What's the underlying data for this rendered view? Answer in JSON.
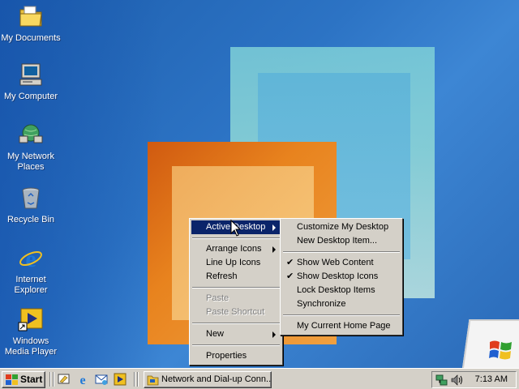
{
  "desktop": {
    "icons": [
      {
        "label": "My Documents",
        "icon": "my-documents-icon"
      },
      {
        "label": "My Computer",
        "icon": "my-computer-icon"
      },
      {
        "label": "My Network Places",
        "icon": "network-places-icon"
      },
      {
        "label": "Recycle Bin",
        "icon": "recycle-bin-icon"
      },
      {
        "label": "Internet Explorer",
        "icon": "internet-explorer-icon"
      },
      {
        "label": "Windows Media Player",
        "icon": "media-player-icon"
      }
    ]
  },
  "context_menu": {
    "items": [
      {
        "label": "Active Desktop",
        "submenu": true,
        "selected": true
      },
      {
        "label": "Arrange Icons",
        "submenu": true
      },
      {
        "label": "Line Up Icons"
      },
      {
        "label": "Refresh"
      },
      {
        "label": "Paste",
        "disabled": true
      },
      {
        "label": "Paste Shortcut",
        "disabled": true
      },
      {
        "label": "New",
        "submenu": true
      },
      {
        "label": "Properties"
      }
    ]
  },
  "submenu": {
    "items": [
      {
        "label": "Customize My Desktop"
      },
      {
        "label": "New Desktop Item..."
      },
      {
        "label": "Show Web Content",
        "checked": true
      },
      {
        "label": "Show Desktop Icons",
        "checked": true
      },
      {
        "label": "Lock Desktop Items"
      },
      {
        "label": "Synchronize"
      },
      {
        "label": "My Current Home Page"
      }
    ]
  },
  "taskbar": {
    "start_label": "Start",
    "quick_launch": [
      "show-desktop-icon",
      "internet-explorer-icon",
      "outlook-express-icon",
      "media-player-icon"
    ],
    "task_label": "Network and Dial-up Conn...",
    "tray_icons": [
      "network-icon",
      "volume-icon"
    ],
    "clock": "7:13 AM"
  },
  "colors": {
    "menu_bg": "#d4d0c8",
    "menu_highlight": "#0a246a",
    "desktop_blue": "#2c73c4"
  }
}
